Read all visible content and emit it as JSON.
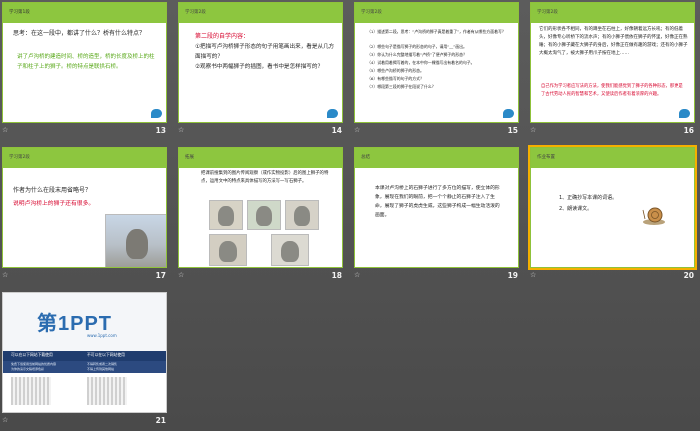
{
  "slides": [
    {
      "number": "13",
      "header": "学习第1段",
      "question": "思考：在这一段中，都讲了什么？桥有什么特点？",
      "answer": "讲了卢沟桥的建造时间、桥的造型，桥的长度及桥上的柱子和柱子上的狮子。桥的特点是联拱石桥。"
    },
    {
      "number": "14",
      "header": "学习第2段",
      "heading": "第二段的自学内容：",
      "items": [
        "①把描写卢沟桥狮子形态的句子用笔画出来，看是从几方面描写的？",
        "②观察书中两幅狮子的插图，看书中是怎样描写的？"
      ]
    },
    {
      "number": "15",
      "header": "学习第2段",
      "lines": [
        "（1）描述第二段，思考：“卢沟桥的狮子真是着重了”，作者有从哪些方面着写？",
        "（2）哪些句子是描写狮子的形态的句子，请用“__”画出。",
        "（3）你认为什么完整地描写着“卢桥”了便卢狮子的形态？",
        "（4）试着用着揭写着的，在本中你一棵描写出有着名的句子。",
        "（5）哪些卢沟桥的狮子的形态。",
        "（6）有哪些描写的句子的方式？",
        "（7）哪段第三段的狮子在段说了什么？"
      ]
    },
    {
      "number": "16",
      "header": "学习第2段",
      "text": "它们的形状各不相同，有的蹲坐在石柱上，好像朝着远方长吼；有的低着头，好像专心听桥下的流水声；有的小狮子偎依在狮子的怀里，好像正在熟睡；有的小狮子藏在大狮子的身后，好像正在做有趣的游戏；还有的小狮子大概太淘气了，被大狮子用爪子按在地上……",
      "note": "自己作为学习者应写法的方法，使我们能感觉到了狮子的各种形态，那更是了古代劳动人民的智慧和艺术，又使读后作者有着浓厚的兴趣。"
    },
    {
      "number": "17",
      "header": "学习第2段",
      "question": "作者为什么在段末用省略号？",
      "answer": "说明卢沟桥上的狮子还有很多。"
    },
    {
      "number": "18",
      "header": "拓展",
      "text": "把课前搜集到的图片传阅观察（或作实物投影）后的图上狮子的特点，运用文中的特点来具体描写的方法写一写石狮子。"
    },
    {
      "number": "19",
      "header": "总结",
      "text": "本课对卢沟桥上的石狮子进行了多方位的描写，使立体的形象，展现在我们的眼前，把一个个静止的石狮子注入了生命，展现了狮子的虎虎生威，这些狮子构成一幅生动活泼的画面。"
    },
    {
      "number": "20",
      "header": "作业布置",
      "items": [
        "1、正确抄写本课的词语。",
        "2、朗读课文。"
      ]
    },
    {
      "number": "21",
      "brand": "第1PPT",
      "url": "www.1ppt.com",
      "left_heading": "可以在以下网站下载使用",
      "right_heading": "不可以在以下网站使用",
      "left_items": [
        "免费下载使用当前网站的优质内容",
        "为你的演示文稿增添色彩"
      ],
      "right_items": [
        "不得转售或者二次销售",
        "不得上传到其他网站"
      ]
    }
  ],
  "icons": {
    "star": "☆",
    "snail": "snail-icon",
    "logo": "ppt-logo-icon"
  },
  "colors": {
    "accent_green": "#8dc63f",
    "text_red": "#d6002a",
    "text_green": "#58a818",
    "brand_blue": "#2b6cb0"
  }
}
